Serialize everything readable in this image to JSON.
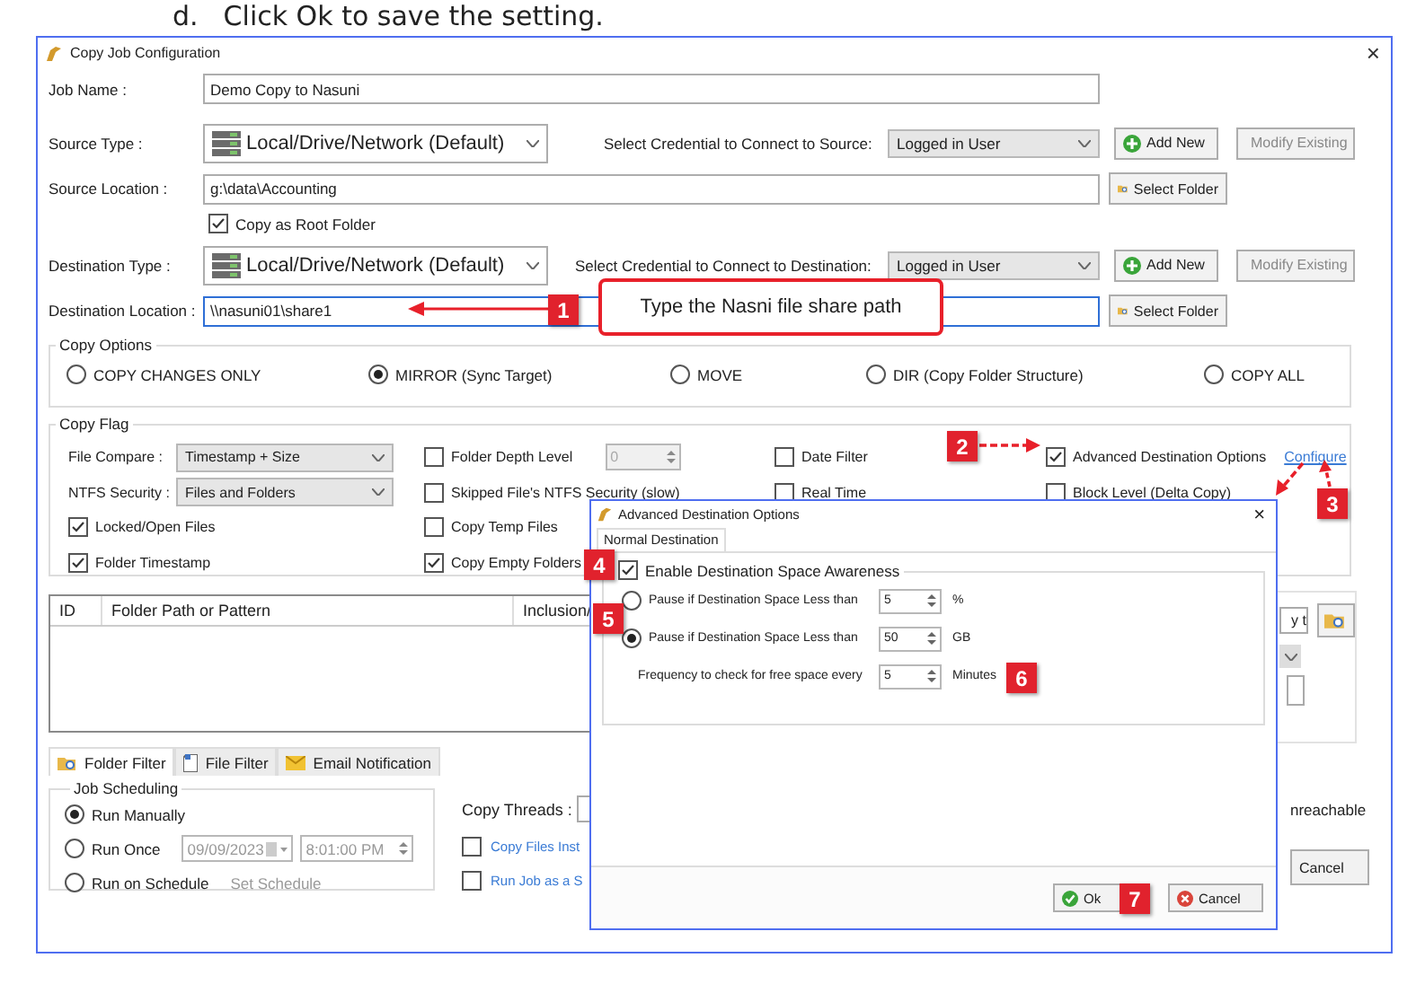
{
  "heading": {
    "marker": "d.",
    "text": "Click Ok to save the setting."
  },
  "window": {
    "title": "Copy Job Configuration",
    "close": "×"
  },
  "form": {
    "job_name": {
      "label": "Job Name :",
      "value": "Demo Copy to Nasuni"
    },
    "source_type": {
      "label": "Source Type :",
      "value": "Local/Drive/Network (Default)",
      "credential_label": "Select Credential to Connect to Source:",
      "credential": "Logged in User",
      "add_button": "Add New",
      "modify_button": "Modify Existing"
    },
    "source_location": {
      "label": "Source Location :",
      "value": "g:\\data\\Accounting",
      "button": "Select Folder"
    },
    "copy_as_root": {
      "label": "Copy as Root Folder",
      "checked": true
    },
    "destination_type": {
      "label": "Destination Type :",
      "value": "Local/Drive/Network (Default)",
      "credential_label": "Select Credential to Connect to Destination:",
      "credential": "Logged in User",
      "add_button": "Add New",
      "modify_button": "Modify Existing"
    },
    "destination_location": {
      "label": "Destination Location :",
      "value": "\\\\nasuni01\\share1",
      "button": "Select Folder"
    }
  },
  "copy_options": {
    "title": "Copy Options",
    "options": [
      {
        "label": "COPY CHANGES ONLY",
        "selected": false
      },
      {
        "label": "MIRROR (Sync Target)",
        "selected": true
      },
      {
        "label": "MOVE",
        "selected": false
      },
      {
        "label": "DIR (Copy Folder Structure)",
        "selected": false
      },
      {
        "label": "COPY ALL",
        "selected": false
      }
    ]
  },
  "copy_flag": {
    "title": "Copy Flag",
    "columns": [
      [
        {
          "kind": "select",
          "label": "File Compare :",
          "value": "Timestamp + Size"
        },
        {
          "kind": "select",
          "label": "NTFS Security :",
          "value": "Files and Folders"
        },
        {
          "kind": "check",
          "label": "Locked/Open Files",
          "checked": true
        },
        {
          "kind": "check",
          "label": "Folder Timestamp",
          "checked": true
        }
      ],
      [
        {
          "kind": "spin_check",
          "label": "Folder Depth Level",
          "checked": false,
          "value": "0"
        },
        {
          "kind": "check",
          "label": "Skipped File's NTFS Security (slow)",
          "checked": false
        },
        {
          "kind": "check",
          "label": "Copy Temp Files",
          "checked": false
        },
        {
          "kind": "check",
          "label": "Copy Empty Folders",
          "checked": true
        }
      ],
      [
        {
          "kind": "check",
          "label": "Date Filter",
          "checked": false
        },
        {
          "kind": "check",
          "label": "Real Time",
          "checked": false
        }
      ],
      [
        {
          "kind": "check_link",
          "label": "Advanced Destination Options",
          "checked": true,
          "link": "Configure"
        },
        {
          "kind": "check",
          "label": "Block Level (Delta Copy)",
          "checked": false
        }
      ]
    ]
  },
  "table": {
    "columns": [
      "ID",
      "Folder Path or Pattern",
      "Inclusion/"
    ]
  },
  "side_panel": {
    "field_value": "y t"
  },
  "tabs": [
    {
      "label": "Folder Filter",
      "selected": true,
      "kind": "folder"
    },
    {
      "label": "File Filter",
      "selected": false,
      "kind": "file"
    },
    {
      "label": "Email Notification",
      "selected": false,
      "kind": "mail"
    }
  ],
  "scheduling": {
    "title": "Job Scheduling",
    "options": [
      {
        "label": "Run Manually",
        "selected": true
      },
      {
        "label": "Run Once",
        "selected": false,
        "date": "09/09/2023",
        "time": "8:01:00 PM"
      },
      {
        "label": "Run on Schedule",
        "selected": false,
        "link": "Set Schedule"
      }
    ]
  },
  "threads": {
    "label": "Copy Threads :",
    "checks": [
      {
        "label": "Copy Files Inst",
        "checked": false
      },
      {
        "label": "Run Job as a S",
        "checked": false
      }
    ]
  },
  "right_area": {
    "label": "nreachable",
    "cancel": "Cancel"
  },
  "dialog": {
    "title": "Advanced Destination Options",
    "close": "×",
    "tab": "Normal Destination",
    "group": {
      "label": "Enable Destination Space Awareness",
      "checked": true
    },
    "rows": [
      {
        "kind": "radio",
        "label": "Pause if Destination Space Less than",
        "selected": false,
        "value": "5",
        "unit": "%"
      },
      {
        "kind": "radio",
        "label": "Pause if Destination Space Less than",
        "selected": true,
        "value": "50",
        "unit": "GB"
      },
      {
        "kind": "plain",
        "label": "Frequency to check for free space every",
        "value": "5",
        "unit": "Minutes"
      }
    ],
    "ok": "Ok",
    "cancel": "Cancel"
  },
  "callouts": {
    "note": "Type the Nasni file share path",
    "badges": [
      "1",
      "2",
      "3",
      "4",
      "5",
      "6",
      "7"
    ]
  }
}
